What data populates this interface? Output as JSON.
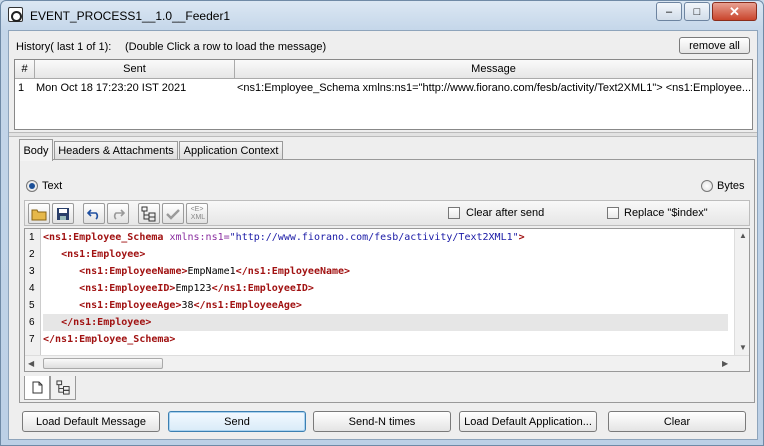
{
  "window": {
    "title": "EVENT_PROCESS1__1.0__Feeder1",
    "minimize_label": "–",
    "maximize_label": "□",
    "close_label": "✕"
  },
  "history": {
    "label": "History( last 1 of 1):",
    "hint": "(Double Click a row to load the message)",
    "remove_all_label": "remove all",
    "columns": [
      "#",
      "Sent",
      "Message"
    ],
    "rows": [
      {
        "index": "1",
        "sent": "Mon Oct 18 17:23:20 IST 2021",
        "message": "<ns1:Employee_Schema xmlns:ns1=\"http://www.fiorano.com/fesb/activity/Text2XML1\">   <ns1:Employee..."
      }
    ]
  },
  "tabs": [
    {
      "label": "Body",
      "active": true
    },
    {
      "label": "Headers & Attachments",
      "active": false
    },
    {
      "label": "Application Context",
      "active": false
    }
  ],
  "body": {
    "radio_text_label": "Text",
    "radio_bytes_label": "Bytes",
    "selected_format": "Text",
    "clear_after_send_label": "Clear after send",
    "replace_index_label": "Replace \"$index\"",
    "clear_after_send_checked": false,
    "replace_index_checked": false,
    "toolbar_icons": [
      "open-folder-icon",
      "save-icon",
      "undo-icon",
      "redo-icon",
      "xml-tree-icon",
      "validate-check-icon",
      "text-to-xml-icon"
    ],
    "xml_icon_text": "<E>\n XML"
  },
  "editor": {
    "line_numbers": [
      "1",
      "2",
      "3",
      "4",
      "5",
      "6",
      "7"
    ],
    "highlighted_line": 6,
    "lines": [
      {
        "tag_open": "<ns1:Employee_Schema ",
        "attr": "xmlns:ns1=",
        "value": "\"http://www.fiorano.com/fesb/activity/Text2XML1\"",
        "tag_close": ">"
      },
      {
        "indent": "   ",
        "tag_open": "<ns1:Employee>"
      },
      {
        "indent": "      ",
        "tag_open": "<ns1:EmployeeName>",
        "text": "EmpName1",
        "tag_close": "</ns1:EmployeeName>"
      },
      {
        "indent": "      ",
        "tag_open": "<ns1:EmployeeID>",
        "text": "Emp123",
        "tag_close": "</ns1:EmployeeID>"
      },
      {
        "indent": "      ",
        "tag_open": "<ns1:EmployeeAge>",
        "text": "38",
        "tag_close": "</ns1:EmployeeAge>"
      },
      {
        "indent": "   ",
        "tag_open": "</ns1:Employee>"
      },
      {
        "indent": "",
        "tag_open": "</ns1:Employee_Schema>"
      }
    ]
  },
  "buttons": {
    "load_default_message": "Load Default Message",
    "send": "Send",
    "send_n_times": "Send-N times",
    "load_default_application": "Load Default Application...",
    "clear": "Clear"
  }
}
